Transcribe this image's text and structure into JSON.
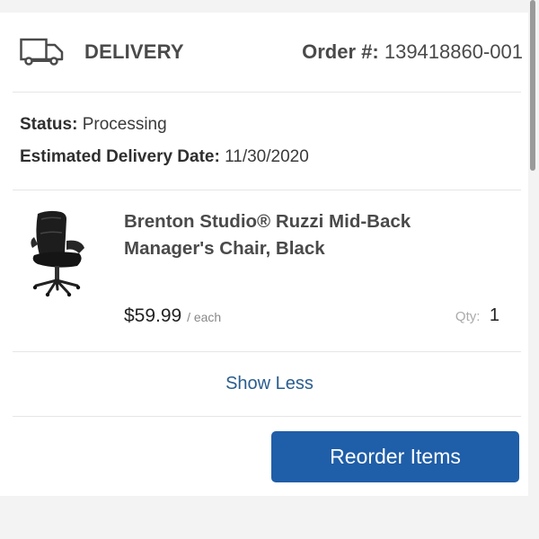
{
  "header": {
    "title": "DELIVERY",
    "order_label": "Order #:",
    "order_number": "139418860-001"
  },
  "status": {
    "label": "Status:",
    "value": "Processing"
  },
  "delivery_date": {
    "label": "Estimated Delivery Date:",
    "value": "11/30/2020"
  },
  "item": {
    "name_line1": "Brenton Studio® Ruzzi Mid-Back",
    "name_line2": "Manager's Chair, Black",
    "price": "$59.99",
    "price_unit": "/ each",
    "qty_label": "Qty:",
    "qty_value": "1"
  },
  "actions": {
    "show_less": "Show Less",
    "reorder": "Reorder Items"
  },
  "colors": {
    "accent": "#1f5ea8",
    "link": "#2a5d8f"
  }
}
